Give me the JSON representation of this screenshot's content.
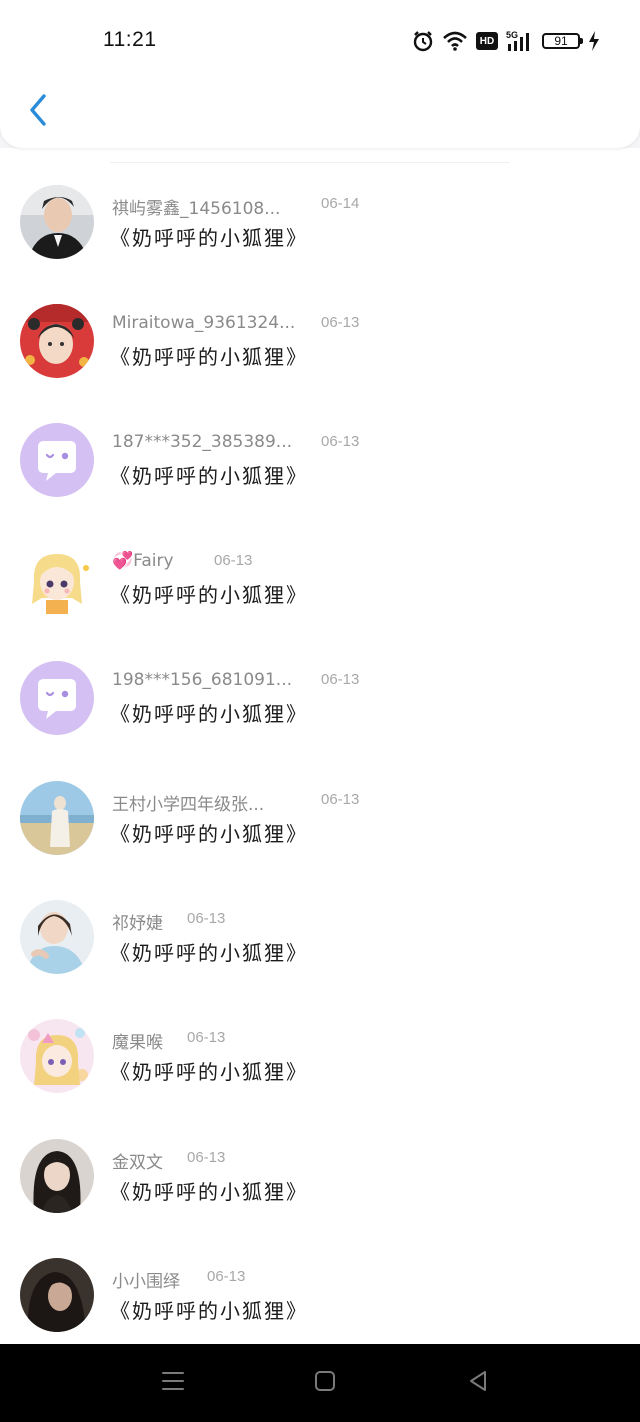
{
  "status_bar": {
    "time": "11:21",
    "battery_level": "91",
    "network": "5G",
    "hd_label": "HD",
    "icons": [
      "alarm-icon",
      "wifi-icon",
      "hd-icon",
      "signal-icon",
      "battery-icon",
      "charging-icon"
    ]
  },
  "header": {
    "back_icon": "chevron-left-icon",
    "accent_color": "#2a8cd9"
  },
  "list": {
    "items": [
      {
        "name": "祺屿雾鑫_1456108...",
        "date": "06-14",
        "message": "《奶呼呼的小狐狸》",
        "avatar": "photo-avatar"
      },
      {
        "name": "Miraitowa_9361324...",
        "date": "06-13",
        "message": "《奶呼呼的小狐狸》",
        "avatar": "photo-avatar"
      },
      {
        "name": "187***352_385389...",
        "date": "06-13",
        "message": "《奶呼呼的小狐狸》",
        "avatar": "default-chat-avatar"
      },
      {
        "name": "💞Fairy",
        "date": "06-13",
        "message": "《奶呼呼的小狐狸》",
        "avatar": "cartoon-avatar"
      },
      {
        "name": "198***156_681091...",
        "date": "06-13",
        "message": "《奶呼呼的小狐狸》",
        "avatar": "default-chat-avatar"
      },
      {
        "name": "王村小学四年级张...",
        "date": "06-13",
        "message": "《奶呼呼的小狐狸》",
        "avatar": "photo-avatar"
      },
      {
        "name": "祁妤婕",
        "date": "06-13",
        "message": "《奶呼呼的小狐狸》",
        "avatar": "photo-avatar"
      },
      {
        "name": "魔果喉",
        "date": "06-13",
        "message": "《奶呼呼的小狐狸》",
        "avatar": "cartoon-avatar"
      },
      {
        "name": "金双文",
        "date": "06-13",
        "message": "《奶呼呼的小狐狸》",
        "avatar": "photo-avatar"
      },
      {
        "name": "小小围绎",
        "date": "06-13",
        "message": "《奶呼呼的小狐狸》",
        "avatar": "photo-avatar"
      }
    ]
  },
  "nav_bar": {
    "icons": [
      "menu-icon",
      "home-square-icon",
      "back-triangle-icon"
    ]
  },
  "colors": {
    "name_text": "#8a8a8a",
    "date_text": "#a8a8a8",
    "message_text": "#1c1c1c",
    "default_avatar_bg": "#d4c0f3"
  }
}
